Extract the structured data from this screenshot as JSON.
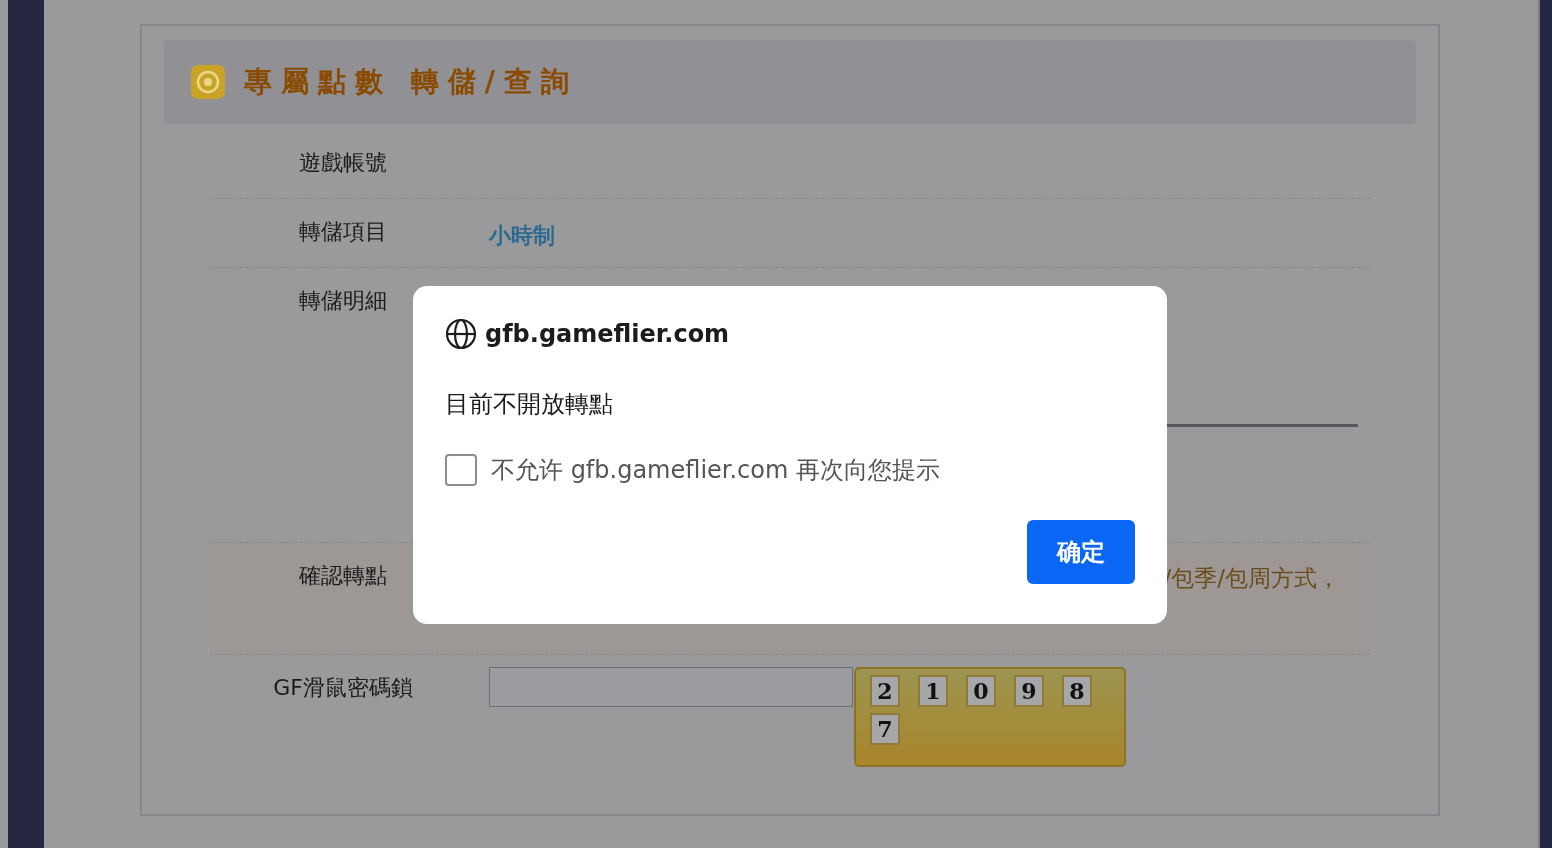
{
  "panel": {
    "title": "專屬點數 轉儲/查詢",
    "rows": [
      {
        "kind": "plain",
        "label": "遊戲帳號"
      },
      {
        "kind": "link",
        "label": "轉儲項目",
        "value": "小時制"
      },
      {
        "kind": "detail",
        "label": "轉儲明細"
      },
      {
        "kind": "notice",
        "label": "確認轉點",
        "value": "/包季/包周方式，"
      },
      {
        "kind": "keypad",
        "label": "GF滑鼠密碼鎖",
        "keys": [
          "2",
          "1",
          "0",
          "9",
          "8",
          "7"
        ]
      }
    ]
  },
  "dialog": {
    "host": "gfb.gameflier.com",
    "message": "目前不開放轉點",
    "checkbox": {
      "label": "不允许 gfb.gameflier.com 再次向您提示",
      "checked": false
    },
    "button": "确定"
  }
}
